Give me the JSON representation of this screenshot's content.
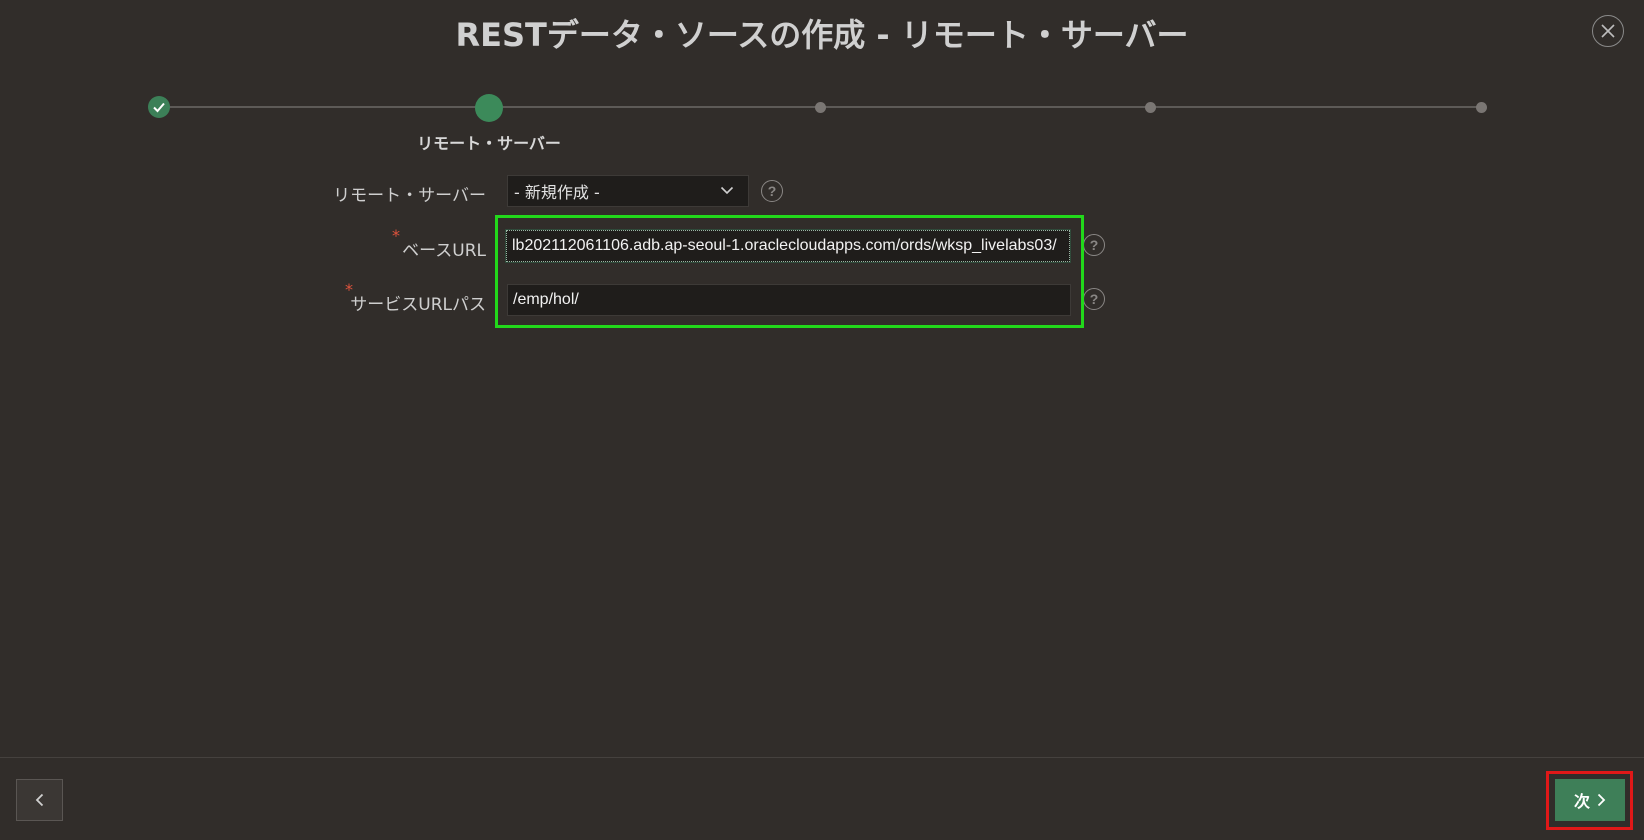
{
  "dialog": {
    "title": "RESTデータ・ソースの作成 - リモート・サーバー",
    "close_icon": "close-icon"
  },
  "wizard": {
    "current_step_label": "リモート・サーバー",
    "total_steps": 5,
    "current_step": 2
  },
  "form": {
    "remote_server": {
      "label": "リモート・サーバー",
      "value": "- 新規作成 -"
    },
    "base_url": {
      "label": "ベースURL",
      "required_mark": "*",
      "value": "lb202112061106.adb.ap-seoul-1.oraclecloudapps.com/ords/wksp_livelabs03/"
    },
    "service_url_path": {
      "label": "サービスURLパス",
      "required_mark": "*",
      "value": "/emp/hol/"
    },
    "help_glyph": "?"
  },
  "footer": {
    "next_label": "次"
  },
  "colors": {
    "background": "#312d2a",
    "accent_green": "#3e7f58",
    "highlight_green": "#22d81b",
    "highlight_red": "#e01818",
    "required_red": "#e0533d"
  }
}
